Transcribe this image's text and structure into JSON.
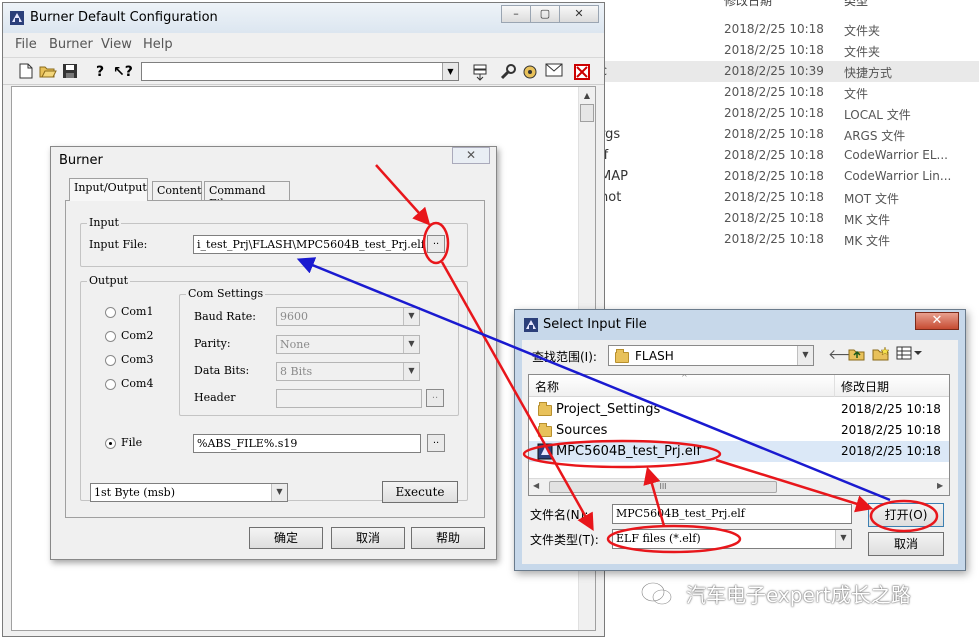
{
  "explorer": {
    "header_date": "修改日期",
    "header_type": "类型",
    "rows": [
      {
        "name": "",
        "date": "2018/2/25 10:18",
        "type": "文件夹"
      },
      {
        "name": "",
        "date": "2018/2/25 10:18",
        "type": "文件夹"
      },
      {
        "name": "c",
        "date": "2018/2/25 10:39",
        "type": "快捷方式"
      },
      {
        "name": "",
        "date": "2018/2/25 10:18",
        "type": "文件"
      },
      {
        "name": "",
        "date": "2018/2/25 10:18",
        "type": "LOCAL 文件"
      },
      {
        "name": "rgs",
        "date": "2018/2/25 10:18",
        "type": "ARGS 文件"
      },
      {
        "name": "lf",
        "date": "2018/2/25 10:18",
        "type": "CodeWarrior EL..."
      },
      {
        "name": "MAP",
        "date": "2018/2/25 10:18",
        "type": "CodeWarrior Lin..."
      },
      {
        "name": "not",
        "date": "2018/2/25 10:18",
        "type": "MOT 文件"
      },
      {
        "name": "",
        "date": "2018/2/25 10:18",
        "type": "MK 文件"
      },
      {
        "name": "",
        "date": "2018/2/25 10:18",
        "type": "MK 文件"
      }
    ]
  },
  "main": {
    "title": "Burner  Default Configuration",
    "menu": [
      "File",
      "Burner",
      "View",
      "Help"
    ],
    "toolbar_combo_value": ""
  },
  "burner": {
    "title": "Burner",
    "tabs": [
      "Input/Output",
      "Content",
      "Command File"
    ],
    "input_group": "Input",
    "input_file_label": "Input File:",
    "input_file_value": "i_test_Prj\\FLASH\\MPC5604B_test_Prj.elf",
    "browse": "..",
    "output_group": "Output",
    "com_settings": "Com Settings",
    "coms": [
      "Com1",
      "Com2",
      "Com3",
      "Com4"
    ],
    "baud_label": "Baud Rate:",
    "baud_value": "9600",
    "parity_label": "Parity:",
    "parity_value": "None",
    "databits_label": "Data Bits:",
    "databits_value": "8 Bits",
    "header_label": "Header",
    "file_label": "File",
    "file_value": "%ABS_FILE%.s19",
    "byte_select": "1st Byte (msb)",
    "execute": "Execute",
    "ok": "确定",
    "cancel": "取消",
    "help": "帮助"
  },
  "select_dlg": {
    "title": "Select Input File",
    "look_in_label": "查找范围(I):",
    "look_in_value": "FLASH",
    "col_name": "名称",
    "col_date": "修改日期",
    "files": [
      {
        "name": "Project_Settings",
        "date": "2018/2/25 10:18"
      },
      {
        "name": "Sources",
        "date": "2018/2/25 10:18"
      },
      {
        "name": "MPC5604B_test_Prj.elf",
        "date": "2018/2/25 10:18"
      }
    ],
    "hscroll_grip": "III",
    "filename_label": "文件名(N):",
    "filename_value": "MPC5604B_test_Prj.elf",
    "filetype_label": "文件类型(T):",
    "filetype_value": "ELF files (*.elf)",
    "open": "打开(O)",
    "cancel": "取消"
  },
  "watermark": "汽车电子expert成长之路",
  "colors": {
    "annotation_red": "#e8161b",
    "annotation_blue": "#1a1ad0"
  }
}
